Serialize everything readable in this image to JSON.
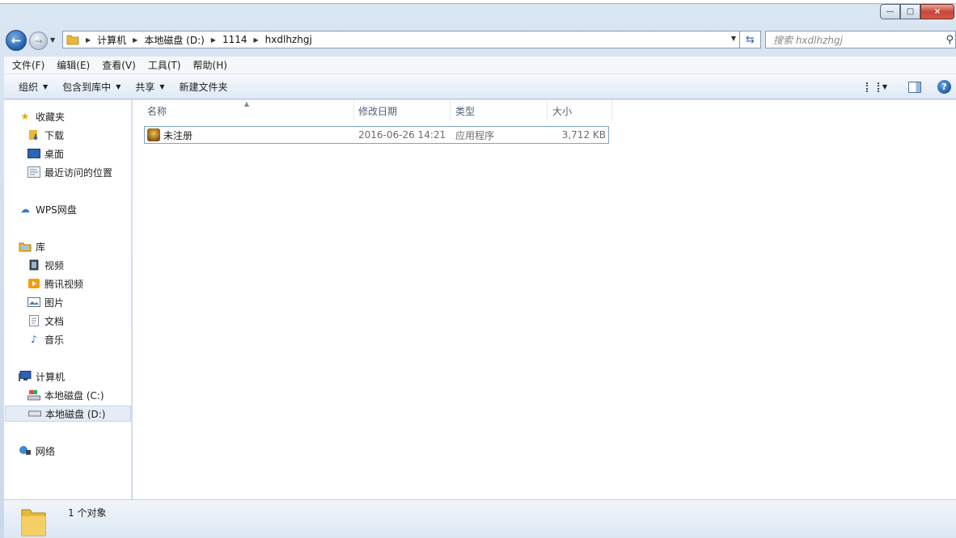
{
  "window": {
    "minimize": "—",
    "maximize": "□",
    "close": "×"
  },
  "address": {
    "crumbs": [
      "计算机",
      "本地磁盘 (D:)",
      "1114",
      "hxdlhzhgj"
    ],
    "search_placeholder": "搜索 hxdlhzhgj"
  },
  "menu": [
    "文件(F)",
    "编辑(E)",
    "查看(V)",
    "工具(T)",
    "帮助(H)"
  ],
  "toolbar": {
    "organize": "组织",
    "include_library": "包含到库中",
    "share": "共享",
    "new_folder": "新建文件夹"
  },
  "nav": {
    "favorites": "收藏夹",
    "downloads": "下载",
    "desktop": "桌面",
    "recent": "最近访问的位置",
    "wps": "WPS网盘",
    "libraries": "库",
    "videos": "视频",
    "tencent_video": "腾讯视频",
    "pictures": "图片",
    "documents": "文档",
    "music": "音乐",
    "computer": "计算机",
    "drive_c": "本地磁盘 (C:)",
    "drive_d": "本地磁盘 (D:)",
    "network": "网络"
  },
  "columns": {
    "name": "名称",
    "date": "修改日期",
    "type": "类型",
    "size": "大小"
  },
  "files": [
    {
      "name": "未注册",
      "date": "2016-06-26 14:21",
      "type": "应用程序",
      "size": "3,712 KB"
    }
  ],
  "status": {
    "count": "1 个对象"
  }
}
